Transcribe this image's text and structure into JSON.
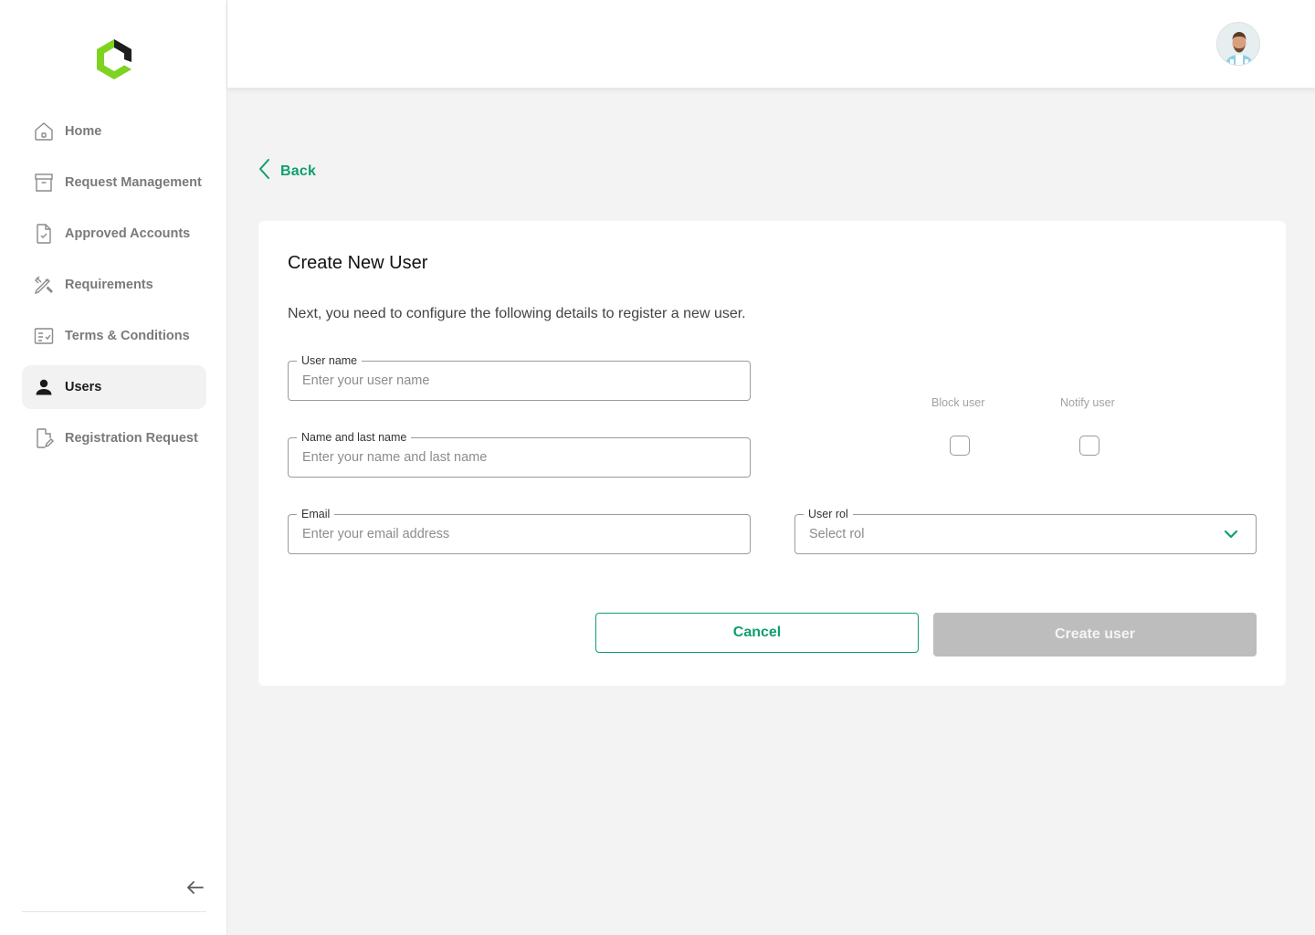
{
  "sidebar": {
    "items": [
      {
        "label": "Home",
        "icon": "home-icon"
      },
      {
        "label": "Request Management",
        "icon": "archive-box-icon"
      },
      {
        "label": "Approved Accounts",
        "icon": "document-check-icon"
      },
      {
        "label": "Requirements",
        "icon": "pencil-ruler-icon"
      },
      {
        "label": "Terms & Conditions",
        "icon": "checklist-icon"
      },
      {
        "label": "Users",
        "icon": "user-icon",
        "active": true
      },
      {
        "label": "Registration Request",
        "icon": "document-edit-icon"
      }
    ],
    "collapse_icon": "arrow-left-icon"
  },
  "header": {
    "avatar": "user-avatar"
  },
  "back": {
    "label": "Back",
    "icon": "chevron-left-icon"
  },
  "form": {
    "title": "Create New User",
    "description": "Next, you need to configure the following details to register a new user.",
    "username": {
      "label": "User name",
      "placeholder": "Enter your user name",
      "value": ""
    },
    "fullname": {
      "label": "Name and last name",
      "placeholder": "Enter your name and last name",
      "value": ""
    },
    "email": {
      "label": "Email",
      "placeholder": "Enter your email address",
      "value": ""
    },
    "role": {
      "label": "User rol",
      "value": "Select rol",
      "icon": "chevron-down-icon"
    },
    "block_user": {
      "label": "Block user",
      "checked": false
    },
    "notify_user": {
      "label": "Notify user",
      "checked": false
    },
    "cancel_label": "Cancel",
    "create_label": "Create user"
  },
  "colors": {
    "accent": "#0e9f6e",
    "logo_green": "#7ed321",
    "disabled_button": "#bdbdbd",
    "background": "#f2f3f2"
  }
}
